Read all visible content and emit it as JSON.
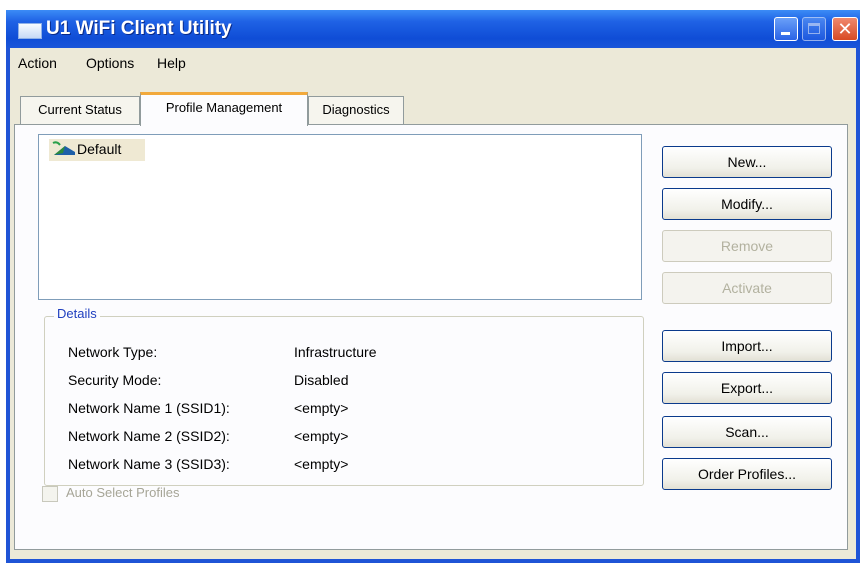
{
  "window": {
    "title": "U1 WiFi Client Utility"
  },
  "menu": {
    "action": "Action",
    "options": "Options",
    "help": "Help"
  },
  "tabs": [
    {
      "label": "Current Status",
      "active": false
    },
    {
      "label": "Profile Management",
      "active": true
    },
    {
      "label": "Diagnostics",
      "active": false
    }
  ],
  "profiles": [
    {
      "name": "Default",
      "selected": true
    }
  ],
  "details": {
    "legend": "Details",
    "rows": [
      {
        "label": "Network Type:",
        "value": "Infrastructure"
      },
      {
        "label": "Security Mode:",
        "value": "Disabled"
      },
      {
        "label": "Network Name 1 (SSID1):",
        "value": "<empty>"
      },
      {
        "label": "Network Name 2 (SSID2):",
        "value": "<empty>"
      },
      {
        "label": "Network Name 3 (SSID3):",
        "value": "<empty>"
      }
    ]
  },
  "auto_select": {
    "label": "Auto Select Profiles",
    "checked": false,
    "enabled": false
  },
  "buttons": {
    "new": "New...",
    "modify": "Modify...",
    "remove": "Remove",
    "activate": "Activate",
    "import": "Import...",
    "export": "Export...",
    "scan": "Scan...",
    "order": "Order Profiles..."
  }
}
